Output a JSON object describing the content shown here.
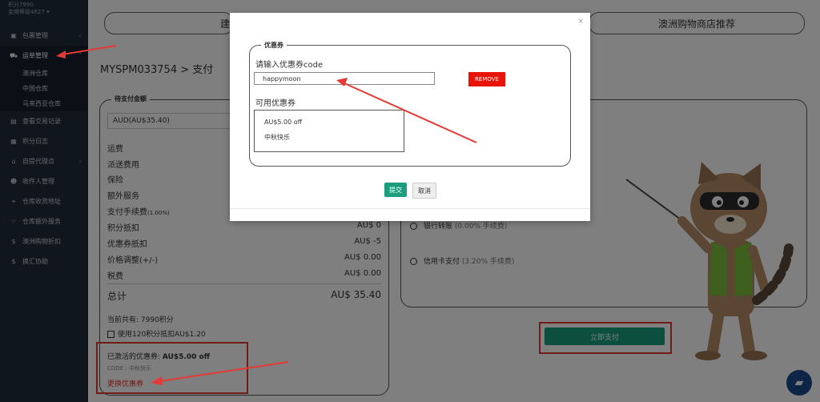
{
  "sidebar": {
    "top_line1": "积分7990",
    "top_line2": "金牌等级4627 ▾",
    "items": [
      {
        "label": "包裹管理",
        "icon": "package-icon"
      },
      {
        "label": "运单管理",
        "icon": "truck-icon"
      },
      {
        "label": "查看交易记录",
        "icon": "receipt-icon"
      },
      {
        "label": "积分日志",
        "icon": "points-icon"
      },
      {
        "label": "自提代理点",
        "icon": "pickup-icon"
      },
      {
        "label": "收件人管理",
        "icon": "user-icon"
      },
      {
        "label": "仓库收货地址",
        "icon": "location-icon"
      },
      {
        "label": "仓库额外服务",
        "icon": "service-icon"
      },
      {
        "label": "澳洲购物折扣",
        "icon": "dollar-icon"
      },
      {
        "label": "换汇协助",
        "icon": "exchange-icon"
      }
    ],
    "subitems": [
      "澳洲仓库",
      "中国仓库",
      "马来西亚仓库"
    ]
  },
  "header": {
    "shop_pill": "澳洲购物商店推荐",
    "left_pill_fragment": "建"
  },
  "breadcrumb": "MYSPM033754 > 支付",
  "payment": {
    "legend": "待支付金额",
    "currency": "AUD(AU$35.40)",
    "rows": [
      {
        "label": "运费",
        "value": ""
      },
      {
        "label": "派送费用",
        "value": ""
      },
      {
        "label": "保险",
        "value": ""
      },
      {
        "label": "额外服务",
        "value": ""
      },
      {
        "label": "支付手续费",
        "note": "(1.00%)",
        "value": ""
      },
      {
        "label": "积分抵扣",
        "value": "AU$ 0"
      },
      {
        "label": "优惠券抵扣",
        "value": "AU$ -5"
      },
      {
        "label": "价格调整(+/-)",
        "value": "AU$ 0.00"
      },
      {
        "label": "税费",
        "value": "AU$ 0.00"
      }
    ],
    "total_label": "总计",
    "total_value": "AU$ 35.40",
    "points_now": "当前共有: 7990积分",
    "use_points": "使用120积分抵扣AU$1.20",
    "activated_label": "已激活的优惠券:",
    "activated_value": "AU$5.00 off",
    "code_line": "CODE : 中秋快乐",
    "change_coupon": "更换优惠券"
  },
  "methods": {
    "bank": "银行转账",
    "bank_fee": "(0.00% 手续费)",
    "card": "信用卡支付",
    "card_fee": "(3.20% 手续费)",
    "pay_now": "立即支付"
  },
  "modal": {
    "close": "×",
    "legend": "优惠券",
    "prompt": "请输入优惠券code",
    "input_value": "happymoon",
    "remove": "REMOVE",
    "available": "可用优惠券",
    "coupon_amount": "AU$5.00 off",
    "coupon_name": "中秋快乐",
    "submit": "提交",
    "cancel": "取消"
  },
  "colors": {
    "sidebar": "#1f2d3d",
    "accent_green": "#1a9e7e",
    "remove_red": "#e8140a",
    "annotation_red": "#e53935"
  }
}
